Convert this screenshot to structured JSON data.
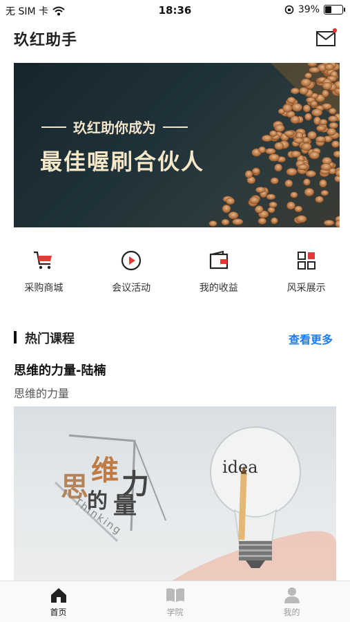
{
  "status_bar": {
    "carrier": "无 SIM 卡",
    "time": "18:36",
    "battery_pct": "39%",
    "battery_level": 0.39
  },
  "header": {
    "title": "玖红助手",
    "mail_icon": "mail-icon",
    "has_unread": true
  },
  "banner": {
    "subtitle": "玖红助你成为",
    "headline": "最佳喔刷合伙人"
  },
  "quick_nav": [
    {
      "label": "采购商城",
      "icon": "cart-icon"
    },
    {
      "label": "会议活动",
      "icon": "play-icon"
    },
    {
      "label": "我的收益",
      "icon": "wallet-icon"
    },
    {
      "label": "风采展示",
      "icon": "grid-icon"
    }
  ],
  "section": {
    "title": "热门课程",
    "more": "查看更多"
  },
  "course": {
    "title": "思维的力量-陆楠",
    "subtitle": "思维的力量",
    "image_text": {
      "c1": "思",
      "c2": "维",
      "c3": "力",
      "c4": "的",
      "c5": "量",
      "en": "Thinking",
      "bulb": "idea"
    }
  },
  "tabbar": [
    {
      "label": "首页",
      "icon": "home-icon",
      "active": true
    },
    {
      "label": "学院",
      "icon": "book-icon",
      "active": false
    },
    {
      "label": "我的",
      "icon": "user-icon",
      "active": false
    }
  ],
  "colors": {
    "accent": "#1a7cf0",
    "brand_red": "#e53935"
  }
}
